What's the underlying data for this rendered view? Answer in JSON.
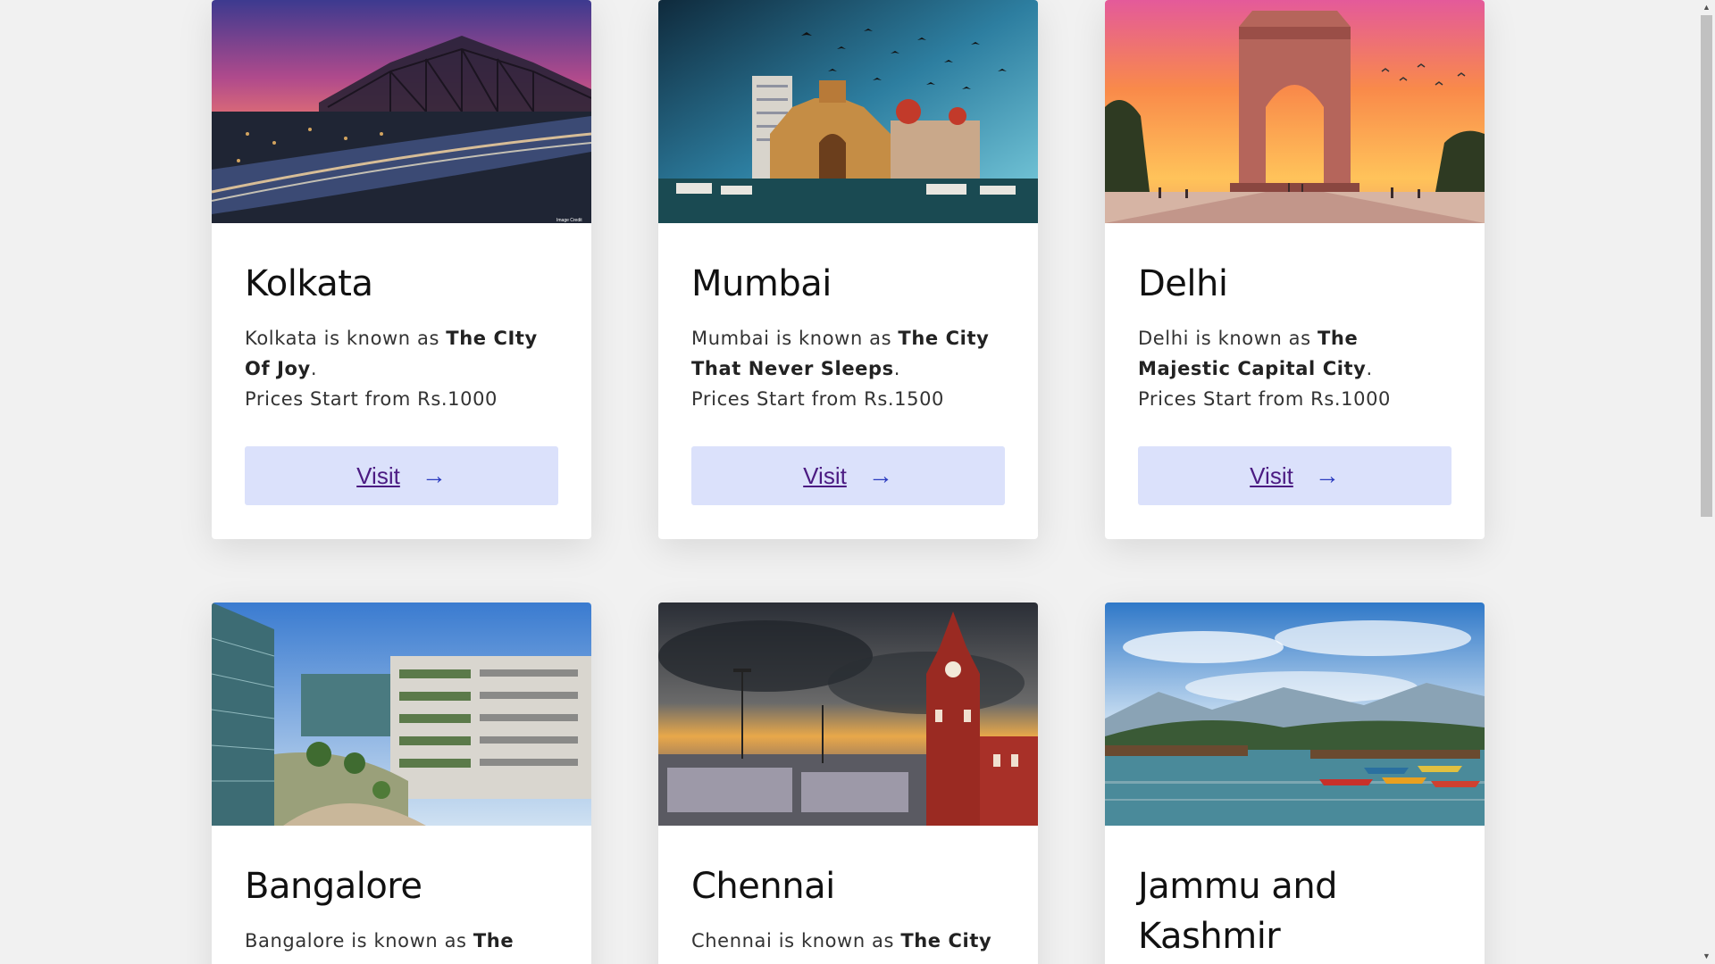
{
  "cards": [
    {
      "name": "Kolkata",
      "desc_prefix": "Kolkata is known as ",
      "desc_bold": "The CIty Of Joy",
      "desc_suffix": ".",
      "price": "Prices Start from Rs.1000",
      "button": "Visit",
      "arrow": "→",
      "credit": "Image Credit"
    },
    {
      "name": "Mumbai",
      "desc_prefix": "Mumbai is known as ",
      "desc_bold": "The City That Never Sleeps",
      "desc_suffix": ".",
      "price": "Prices Start from Rs.1500",
      "button": "Visit",
      "arrow": "→"
    },
    {
      "name": "Delhi",
      "desc_prefix": "Delhi is known as ",
      "desc_bold": "The Majestic Capital City",
      "desc_suffix": ".",
      "price": "Prices Start from Rs.1000",
      "button": "Visit",
      "arrow": "→"
    },
    {
      "name": "Bangalore",
      "desc_prefix": "Bangalore is known as ",
      "desc_bold": "The"
    },
    {
      "name": "Chennai",
      "desc_prefix": "Chennai is known as ",
      "desc_bold": "The City"
    },
    {
      "name": "Jammu and Kashmir"
    }
  ],
  "scrollbar": {
    "up": "▲",
    "down": "▼"
  }
}
